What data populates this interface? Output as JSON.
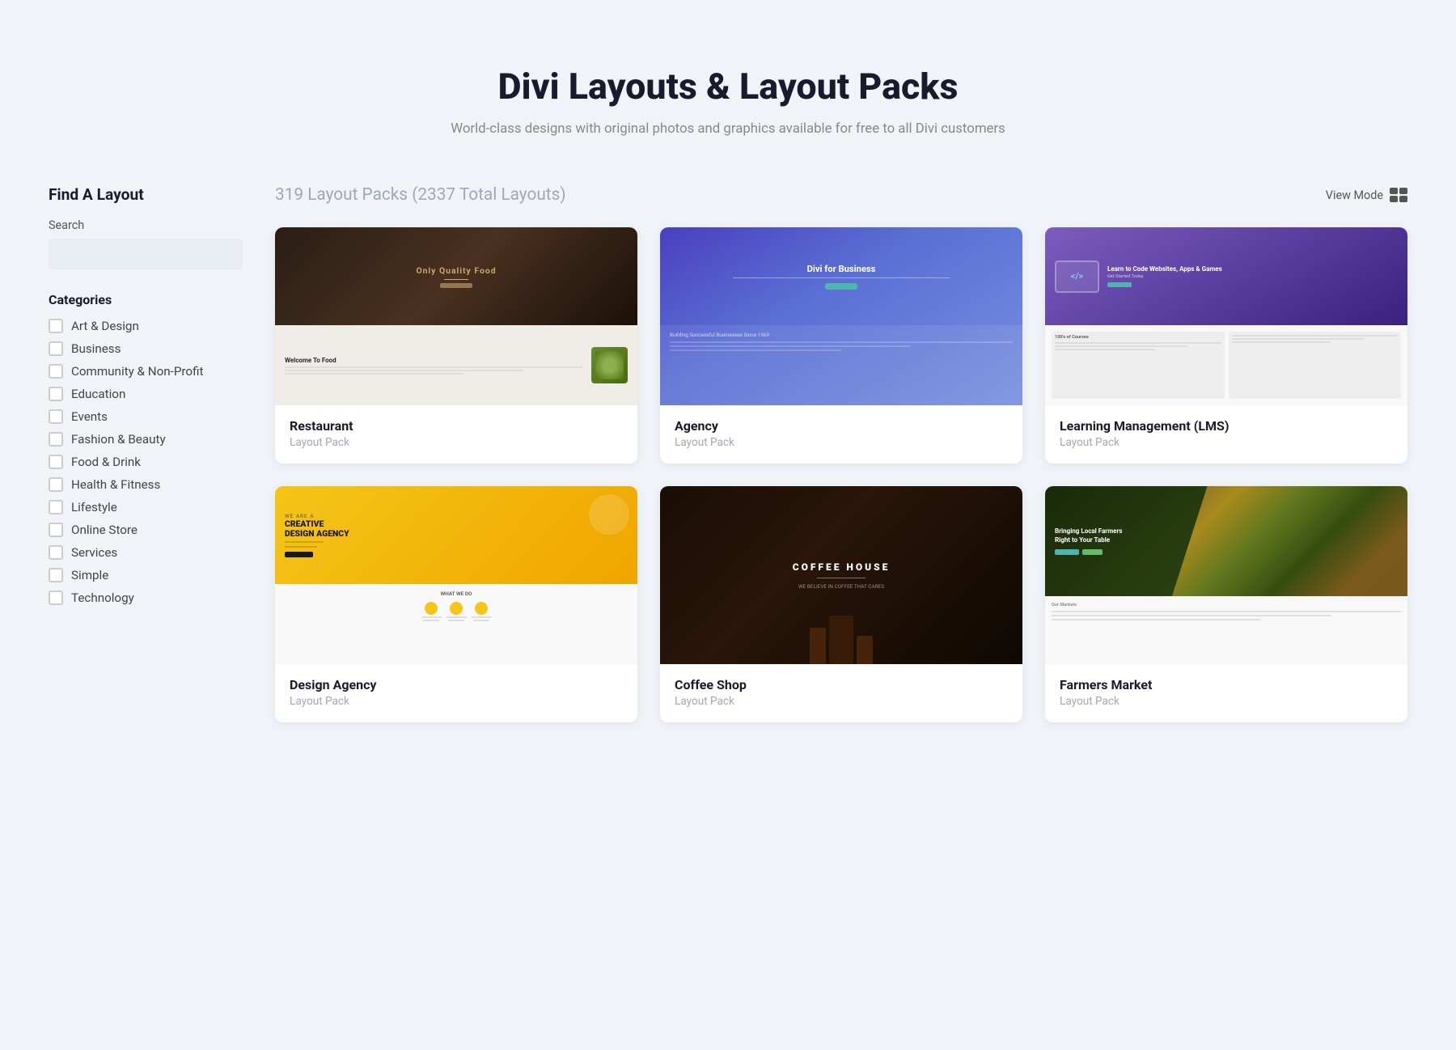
{
  "page": {
    "title": "Divi Layouts & Layout Packs",
    "subtitle": "World-class designs with original photos and graphics available for free to all Divi customers"
  },
  "sidebar": {
    "title": "Find A Layout",
    "search": {
      "label": "Search",
      "placeholder": ""
    },
    "categories_title": "Categories",
    "categories": [
      {
        "id": "art-design",
        "label": "Art & Design",
        "checked": false
      },
      {
        "id": "business",
        "label": "Business",
        "checked": false
      },
      {
        "id": "community",
        "label": "Community & Non-Profit",
        "checked": false
      },
      {
        "id": "education",
        "label": "Education",
        "checked": false
      },
      {
        "id": "events",
        "label": "Events",
        "checked": false
      },
      {
        "id": "fashion-beauty",
        "label": "Fashion & Beauty",
        "checked": false
      },
      {
        "id": "food-drink",
        "label": "Food & Drink",
        "checked": false
      },
      {
        "id": "health-fitness",
        "label": "Health & Fitness",
        "checked": false
      },
      {
        "id": "lifestyle",
        "label": "Lifestyle",
        "checked": false
      },
      {
        "id": "online-store",
        "label": "Online Store",
        "checked": false
      },
      {
        "id": "services",
        "label": "Services",
        "checked": false
      },
      {
        "id": "simple",
        "label": "Simple",
        "checked": false
      },
      {
        "id": "technology",
        "label": "Technology",
        "checked": false
      }
    ]
  },
  "main": {
    "layout_count": "319 Layout Packs",
    "total_layouts": "(2337 Total Layouts)",
    "view_mode_label": "View Mode",
    "cards": [
      {
        "id": "restaurant",
        "title": "Restaurant",
        "type": "Layout Pack",
        "preview_type": "restaurant"
      },
      {
        "id": "agency",
        "title": "Agency",
        "type": "Layout Pack",
        "preview_type": "agency"
      },
      {
        "id": "lms",
        "title": "Learning Management (LMS)",
        "type": "Layout Pack",
        "preview_type": "lms"
      },
      {
        "id": "design-agency",
        "title": "Design Agency",
        "type": "Layout Pack",
        "preview_type": "design"
      },
      {
        "id": "coffee-shop",
        "title": "Coffee Shop",
        "type": "Layout Pack",
        "preview_type": "coffee"
      },
      {
        "id": "farmers-market",
        "title": "Farmers Market",
        "type": "Layout Pack",
        "preview_type": "farmers"
      }
    ]
  }
}
